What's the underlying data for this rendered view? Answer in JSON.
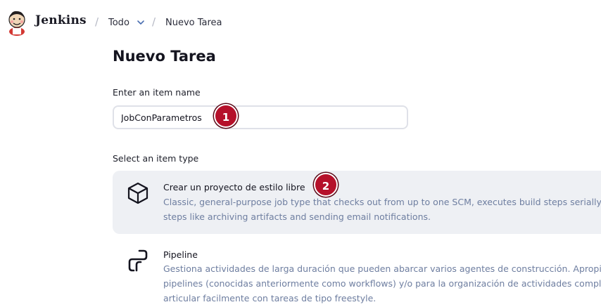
{
  "header": {
    "brand": "Jenkins",
    "breadcrumbs": [
      {
        "label": "Todo",
        "has_dropdown": true
      },
      {
        "label": "Nuevo Tarea"
      }
    ],
    "separator": "/"
  },
  "main": {
    "title": "Nuevo Tarea",
    "name_label": "Enter an item name",
    "name_value": "JobConParametros",
    "type_label": "Select an item type",
    "item_types": [
      {
        "title": "Crear un proyecto de estilo libre",
        "description_lines": [
          "Classic, general-purpose job type that checks out from up to one SCM, executes build steps serially, f",
          "steps like archiving artifacts and sending email notifications."
        ],
        "icon": "freestyle-box-icon",
        "selected": true
      },
      {
        "title": "Pipeline",
        "description_lines": [
          "Gestiona actividades de larga duración que pueden abarcar varios agentes de construcción. Apropiad",
          "pipelines (conocidas anteriormente como workflows) y/o para la organización de actividades complej",
          "articular facilmente con tareas de tipo freestyle."
        ],
        "icon": "pipeline-icon",
        "selected": false
      }
    ]
  },
  "annotations": {
    "badge_1": "1",
    "badge_2": "2",
    "color": "#b5102a"
  },
  "colors": {
    "selected_background": "#eef0f4",
    "description_text": "#6e7ea0",
    "input_border": "#dfe1e8"
  }
}
